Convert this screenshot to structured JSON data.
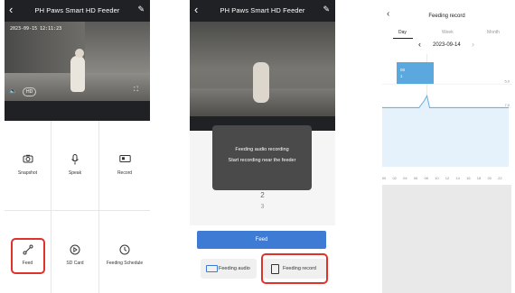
{
  "panel1": {
    "title": "PH Paws Smart HD Feeder",
    "timestamp": "2023-09-15 12:11:23",
    "hd_label": "HD",
    "buttons": [
      {
        "label": "Snapshot",
        "icon": "camera-icon"
      },
      {
        "label": "Speak",
        "icon": "microphone-icon"
      },
      {
        "label": "Record",
        "icon": "video-record-icon"
      },
      {
        "label": "Feed",
        "icon": "bone-icon"
      },
      {
        "label": "SD Card",
        "icon": "sd-card-play-icon"
      },
      {
        "label": "Feeding Schedule",
        "icon": "clock-icon"
      }
    ]
  },
  "panel2": {
    "title": "PH Paws Smart HD Feeder",
    "modal_title": "Feeding audio recording",
    "modal_subtitle": "Start recording near the feeder",
    "picker_values": [
      "2",
      "3"
    ],
    "feed_button": "Feed",
    "feeding_audio_button": "Feeding audio",
    "feeding_record_button": "Feeding record"
  },
  "panel3": {
    "title": "Feeding record",
    "tabs": [
      "Day",
      "Week",
      "Month"
    ],
    "active_tab": "Day",
    "date": "2023-09-14",
    "y_ticks": [
      "7.0",
      "5.0"
    ],
    "event_card": {
      "time": "08",
      "count": "1"
    }
  },
  "chart_data": {
    "type": "line",
    "title": "",
    "xlabel": "",
    "ylabel": "",
    "categories": [
      "00",
      "02",
      "04",
      "06",
      "08",
      "10",
      "12",
      "14",
      "16",
      "18",
      "20",
      "22"
    ],
    "x": [
      0,
      2,
      4,
      6,
      7,
      8,
      8.5,
      9,
      10,
      12,
      14,
      16,
      18,
      20,
      22,
      24
    ],
    "series": [
      {
        "values": [
          5.0,
          5.0,
          5.0,
          5.0,
          5.0,
          5.6,
          6.0,
          5.0,
          5.0,
          5.0,
          5.0,
          5.0,
          5.0,
          5.0,
          5.0,
          5.0
        ]
      }
    ],
    "xlim": [
      0,
      24
    ],
    "ylim": [
      0,
      8
    ],
    "y_tick_values": [
      5.0,
      7.0
    ],
    "grid": true,
    "legend": "none",
    "colors": {
      "line": "#5aa8de",
      "fill": "#e5f2fb",
      "event": "#4aa3df"
    }
  },
  "colors": {
    "accent": "#3d7bd5",
    "highlight": "#e0322b",
    "dark_header": "#202124",
    "modal": "#4a4a4a"
  }
}
